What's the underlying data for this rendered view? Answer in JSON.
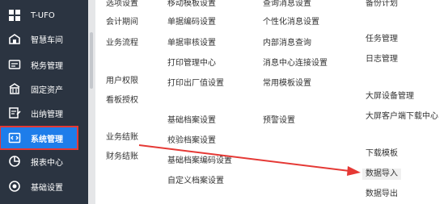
{
  "sidebar": {
    "items": [
      {
        "label": "T-UFO",
        "icon": "grid-icon"
      },
      {
        "label": "智慧车间",
        "icon": "factory-icon"
      },
      {
        "label": "税务管理",
        "icon": "tax-invoice-icon"
      },
      {
        "label": "固定资产",
        "icon": "asset-box-icon"
      },
      {
        "label": "出纳管理",
        "icon": "cashier-edit-icon"
      },
      {
        "label": "系统管理",
        "icon": "code-window-icon",
        "active": true
      },
      {
        "label": "报表中心",
        "icon": "pie-chart-icon"
      },
      {
        "label": "基础设置",
        "icon": "target-icon"
      }
    ]
  },
  "menu": {
    "col1": [
      "选项设置",
      "会计期间",
      "业务流程",
      "用户权限",
      "看板授权",
      "业务结账",
      "财务结账"
    ],
    "col2": [
      "移动模板设置",
      "单据编码设置",
      "单据审核设置",
      "打印管理中心",
      "打印出厂值设置",
      "基础档案设置",
      "校验档案设置",
      "基础档案编码设置",
      "自定义档案设置"
    ],
    "col3": [
      "查询消息设置",
      "个性化消息设置",
      "内部消息查询",
      "消息中心连接设置",
      "常用模板设置",
      "预警设置"
    ],
    "col4": [
      "备份计划",
      "任务管理",
      "日志管理",
      "大屏设备管理",
      "大屏客户端下载中心",
      "下载模板",
      "数据导入",
      "数据导出"
    ]
  },
  "colors": {
    "sidebar_bg": "#2b3441",
    "active_bg": "#1e7dea",
    "annotation_red": "#e53935"
  }
}
